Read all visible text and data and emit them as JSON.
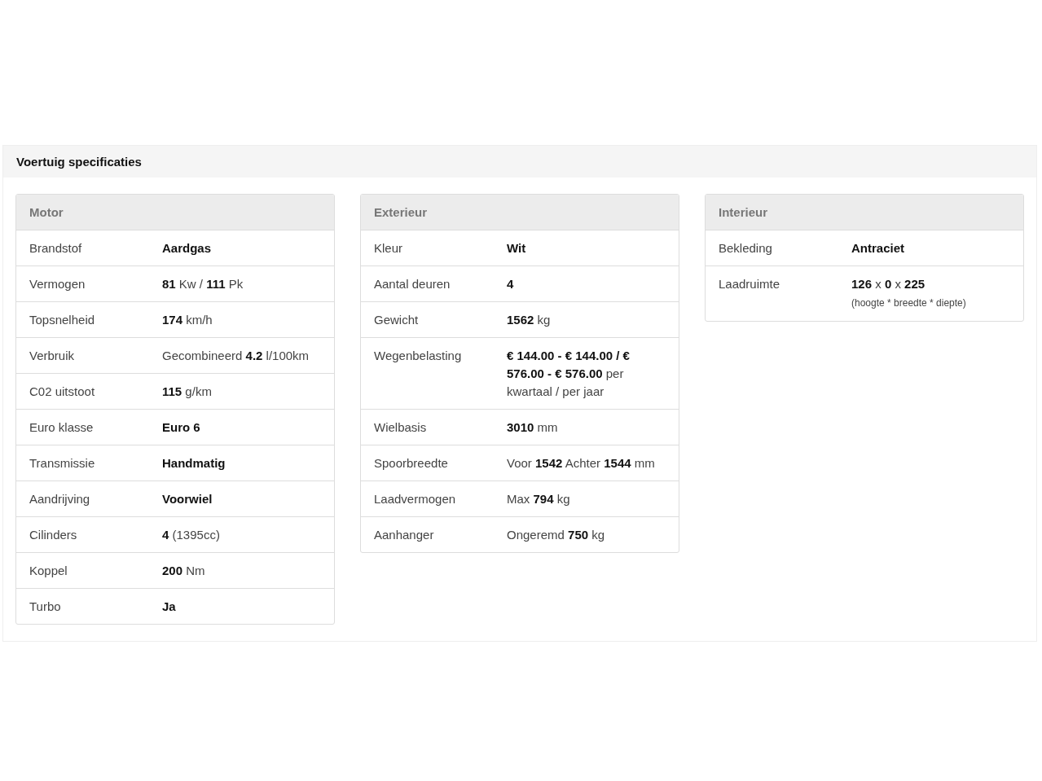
{
  "panel": {
    "title": "Voertuig specificaties"
  },
  "cards": [
    {
      "title": "Motor",
      "rows": [
        {
          "label": "Brandstof",
          "value": "Aardgas",
          "bold": true
        },
        {
          "label": "Vermogen",
          "value": "**81** Kw / **111** Pk",
          "bold": false
        },
        {
          "label": "Topsnelheid",
          "value": "**174** km/h",
          "bold": false
        },
        {
          "label": "Verbruik",
          "value": "Gecombineerd **4.2** l/100km",
          "bold": false
        },
        {
          "label": "C02 uitstoot",
          "value": "**115** g/km",
          "bold": false
        },
        {
          "label": "Euro klasse",
          "value": "Euro 6",
          "bold": true
        },
        {
          "label": "Transmissie",
          "value": "Handmatig",
          "bold": true
        },
        {
          "label": "Aandrijving",
          "value": "Voorwiel",
          "bold": true
        },
        {
          "label": "Cilinders",
          "value": "**4** (1395cc)",
          "bold": false
        },
        {
          "label": "Koppel",
          "value": "**200** Nm",
          "bold": false
        },
        {
          "label": "Turbo",
          "value": "Ja",
          "bold": true
        }
      ]
    },
    {
      "title": "Exterieur",
      "rows": [
        {
          "label": "Kleur",
          "value": "Wit",
          "bold": true
        },
        {
          "label": "Aantal deuren",
          "value": "4",
          "bold": true
        },
        {
          "label": "Gewicht",
          "value": "**1562** kg",
          "bold": false
        },
        {
          "label": "Wegenbelasting",
          "value": "**€ 144.00 - € 144.00 / € 576.00 - € 576.00** per kwartaal / per jaar",
          "bold": false
        },
        {
          "label": "Wielbasis",
          "value": "**3010** mm",
          "bold": false
        },
        {
          "label": "Spoorbreedte",
          "value": "Voor **1542** Achter **1544** mm",
          "bold": false
        },
        {
          "label": "Laadvermogen",
          "value": "Max **794** kg",
          "bold": false
        },
        {
          "label": "Aanhanger",
          "value": "Ongeremd **750** kg",
          "bold": false
        }
      ]
    },
    {
      "title": "Interieur",
      "rows": [
        {
          "label": "Bekleding",
          "value": "Antraciet",
          "bold": true
        },
        {
          "label": "Laadruimte",
          "value": "**126** x **0** x **225**",
          "bold": false,
          "note": "(hoogte * breedte * diepte)"
        }
      ]
    }
  ]
}
